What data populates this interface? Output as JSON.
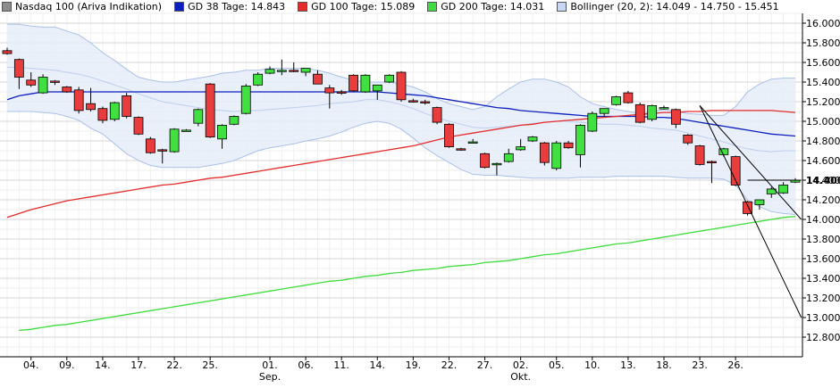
{
  "legend": [
    {
      "label": "Nasdaq 100 (Ariva Indikation)",
      "color": "#8c8c8c"
    },
    {
      "label": "GD 38 Tage: 14.843",
      "color": "#0b1fbf"
    },
    {
      "label": "GD 100 Tage: 15.089",
      "color": "#e42b2b"
    },
    {
      "label": "GD 200 Tage: 14.031",
      "color": "#3fdc3f"
    },
    {
      "label": "Bollinger (20, 2): 14.049 - 14.750 - 15.451",
      "color": "#a8c0e8"
    }
  ],
  "chart_data": {
    "type": "candlestick",
    "ylim": [
      12.6,
      16.1
    ],
    "y_ticks": [
      "16.000",
      "15.800",
      "15.600",
      "15.400",
      "15.200",
      "15.000",
      "14.800",
      "14.600",
      "14.400",
      "14.200",
      "14.000",
      "13.800",
      "13.600",
      "13.400",
      "13.200",
      "13.000",
      "12.800"
    ],
    "x_ticks": [
      "04.",
      "09.",
      "14.",
      "17.",
      "22.",
      "25.",
      "01.",
      "06.",
      "11.",
      "14.",
      "19.",
      "22.",
      "27.",
      "02.",
      "05.",
      "10.",
      "13.",
      "18.",
      "23.",
      "26."
    ],
    "x_month_labels": [
      "Sep.",
      "Okt."
    ],
    "last_value": "14.400",
    "candles": [
      {
        "o": 15.72,
        "h": 15.75,
        "l": 15.68,
        "c": 15.69
      },
      {
        "o": 15.63,
        "h": 15.64,
        "l": 15.33,
        "c": 15.45
      },
      {
        "o": 15.42,
        "h": 15.5,
        "l": 15.35,
        "c": 15.37
      },
      {
        "o": 15.29,
        "h": 15.48,
        "l": 15.28,
        "c": 15.45
      },
      {
        "o": 15.41,
        "h": 15.42,
        "l": 15.37,
        "c": 15.4
      },
      {
        "o": 15.35,
        "h": 15.36,
        "l": 15.29,
        "c": 15.3
      },
      {
        "o": 15.32,
        "h": 15.35,
        "l": 15.08,
        "c": 15.11
      },
      {
        "o": 15.18,
        "h": 15.34,
        "l": 15.1,
        "c": 15.12
      },
      {
        "o": 15.13,
        "h": 15.15,
        "l": 14.98,
        "c": 15.01
      },
      {
        "o": 15.02,
        "h": 15.2,
        "l": 15.0,
        "c": 15.19
      },
      {
        "o": 15.26,
        "h": 15.29,
        "l": 15.03,
        "c": 15.05
      },
      {
        "o": 15.04,
        "h": 15.05,
        "l": 14.86,
        "c": 14.87
      },
      {
        "o": 14.82,
        "h": 14.84,
        "l": 14.67,
        "c": 14.68
      },
      {
        "o": 14.71,
        "h": 14.72,
        "l": 14.57,
        "c": 14.7
      },
      {
        "o": 14.69,
        "h": 14.93,
        "l": 14.68,
        "c": 14.92
      },
      {
        "o": 14.91,
        "h": 14.92,
        "l": 14.9,
        "c": 14.91
      },
      {
        "o": 14.98,
        "h": 15.13,
        "l": 14.95,
        "c": 15.12
      },
      {
        "o": 15.38,
        "h": 15.39,
        "l": 14.83,
        "c": 14.84
      },
      {
        "o": 14.82,
        "h": 14.97,
        "l": 14.72,
        "c": 14.96
      },
      {
        "o": 14.97,
        "h": 15.06,
        "l": 14.96,
        "c": 15.05
      },
      {
        "o": 15.08,
        "h": 15.38,
        "l": 15.07,
        "c": 15.36
      },
      {
        "o": 15.37,
        "h": 15.5,
        "l": 15.36,
        "c": 15.48
      },
      {
        "o": 15.49,
        "h": 15.56,
        "l": 15.48,
        "c": 15.53
      },
      {
        "o": 15.52,
        "h": 15.63,
        "l": 15.47,
        "c": 15.52
      },
      {
        "o": 15.52,
        "h": 15.6,
        "l": 15.5,
        "c": 15.51
      },
      {
        "o": 15.5,
        "h": 15.53,
        "l": 15.46,
        "c": 15.54
      },
      {
        "o": 15.48,
        "h": 15.52,
        "l": 15.38,
        "c": 15.38
      },
      {
        "o": 15.34,
        "h": 15.37,
        "l": 15.13,
        "c": 15.29
      },
      {
        "o": 15.3,
        "h": 15.32,
        "l": 15.27,
        "c": 15.29
      },
      {
        "o": 15.47,
        "h": 15.48,
        "l": 15.3,
        "c": 15.31
      },
      {
        "o": 15.3,
        "h": 15.48,
        "l": 15.29,
        "c": 15.47
      },
      {
        "o": 15.31,
        "h": 15.35,
        "l": 15.22,
        "c": 15.37
      },
      {
        "o": 15.4,
        "h": 15.48,
        "l": 15.39,
        "c": 15.47
      },
      {
        "o": 15.5,
        "h": 15.51,
        "l": 15.2,
        "c": 15.22
      },
      {
        "o": 15.21,
        "h": 15.23,
        "l": 15.19,
        "c": 15.2
      },
      {
        "o": 15.2,
        "h": 15.22,
        "l": 15.17,
        "c": 15.19
      },
      {
        "o": 15.14,
        "h": 15.15,
        "l": 14.97,
        "c": 14.99
      },
      {
        "o": 14.97,
        "h": 14.98,
        "l": 14.73,
        "c": 14.74
      },
      {
        "o": 14.72,
        "h": 14.73,
        "l": 14.7,
        "c": 14.71
      },
      {
        "o": 14.79,
        "h": 14.82,
        "l": 14.78,
        "c": 14.79
      },
      {
        "o": 14.67,
        "h": 14.68,
        "l": 14.52,
        "c": 14.53
      },
      {
        "o": 14.56,
        "h": 14.58,
        "l": 14.45,
        "c": 14.57
      },
      {
        "o": 14.59,
        "h": 14.72,
        "l": 14.58,
        "c": 14.67
      },
      {
        "o": 14.71,
        "h": 14.82,
        "l": 14.7,
        "c": 14.74
      },
      {
        "o": 14.8,
        "h": 14.85,
        "l": 14.79,
        "c": 14.84
      },
      {
        "o": 14.78,
        "h": 14.79,
        "l": 14.55,
        "c": 14.58
      },
      {
        "o": 14.52,
        "h": 14.8,
        "l": 14.5,
        "c": 14.78
      },
      {
        "o": 14.78,
        "h": 14.8,
        "l": 14.72,
        "c": 14.73
      },
      {
        "o": 14.66,
        "h": 14.97,
        "l": 14.53,
        "c": 14.96
      },
      {
        "o": 14.9,
        "h": 15.1,
        "l": 14.89,
        "c": 15.08
      },
      {
        "o": 15.08,
        "h": 15.12,
        "l": 15.05,
        "c": 15.13
      },
      {
        "o": 15.17,
        "h": 15.26,
        "l": 15.16,
        "c": 15.25
      },
      {
        "o": 15.29,
        "h": 15.31,
        "l": 15.18,
        "c": 15.19
      },
      {
        "o": 15.17,
        "h": 15.19,
        "l": 14.98,
        "c": 14.99
      },
      {
        "o": 15.02,
        "h": 15.17,
        "l": 15.0,
        "c": 15.16
      },
      {
        "o": 15.13,
        "h": 15.16,
        "l": 15.12,
        "c": 15.14
      },
      {
        "o": 15.12,
        "h": 15.13,
        "l": 14.93,
        "c": 14.97
      },
      {
        "o": 14.86,
        "h": 14.87,
        "l": 14.76,
        "c": 14.78
      },
      {
        "o": 14.75,
        "h": 14.76,
        "l": 14.55,
        "c": 14.56
      },
      {
        "o": 14.59,
        "h": 14.6,
        "l": 14.37,
        "c": 14.58
      },
      {
        "o": 14.66,
        "h": 14.73,
        "l": 14.64,
        "c": 14.72
      },
      {
        "o": 14.64,
        "h": 14.65,
        "l": 14.34,
        "c": 14.35
      },
      {
        "o": 14.18,
        "h": 14.19,
        "l": 14.04,
        "c": 14.06
      },
      {
        "o": 14.15,
        "h": 14.2,
        "l": 14.1,
        "c": 14.2
      },
      {
        "o": 14.26,
        "h": 14.33,
        "l": 14.22,
        "c": 14.31
      },
      {
        "o": 14.27,
        "h": 14.38,
        "l": 14.26,
        "c": 14.35
      },
      {
        "o": 14.38,
        "h": 14.42,
        "l": 14.37,
        "c": 14.4
      }
    ],
    "series": [
      {
        "name": "GD 38 Tage",
        "color": "#0b1fbf",
        "values": [
          15.22,
          15.26,
          15.28,
          15.3,
          15.3,
          15.3,
          15.3,
          15.3,
          15.3,
          15.3,
          15.3,
          15.3,
          15.3,
          15.3,
          15.3,
          15.3,
          15.3,
          15.3,
          15.3,
          15.3,
          15.3,
          15.3,
          15.3,
          15.3,
          15.3,
          15.3,
          15.3,
          15.3,
          15.3,
          15.3,
          15.3,
          15.3,
          15.29,
          15.28,
          15.27,
          15.26,
          15.24,
          15.22,
          15.2,
          15.18,
          15.16,
          15.14,
          15.13,
          15.11,
          15.1,
          15.09,
          15.08,
          15.07,
          15.06,
          15.05,
          15.05,
          15.05,
          15.05,
          15.05,
          15.04,
          15.04,
          15.03,
          15.01,
          14.99,
          14.97,
          14.95,
          14.93,
          14.91,
          14.89,
          14.87,
          14.86,
          14.85
        ]
      },
      {
        "name": "GD 100 Tage",
        "color": "#e42b2b",
        "values": [
          14.02,
          14.06,
          14.1,
          14.13,
          14.16,
          14.19,
          14.21,
          14.23,
          14.25,
          14.27,
          14.29,
          14.31,
          14.33,
          14.35,
          14.36,
          14.38,
          14.4,
          14.42,
          14.43,
          14.45,
          14.47,
          14.49,
          14.51,
          14.53,
          14.55,
          14.57,
          14.59,
          14.61,
          14.63,
          14.65,
          14.67,
          14.69,
          14.71,
          14.73,
          14.75,
          14.78,
          14.81,
          14.84,
          14.86,
          14.88,
          14.9,
          14.92,
          14.94,
          14.96,
          14.97,
          14.99,
          15.0,
          15.01,
          15.02,
          15.03,
          15.04,
          15.05,
          15.06,
          15.07,
          15.08,
          15.09,
          15.09,
          15.1,
          15.1,
          15.11,
          15.11,
          15.11,
          15.11,
          15.11,
          15.11,
          15.1,
          15.09
        ]
      },
      {
        "name": "GD 200 Tage",
        "color": "#3fdc3f",
        "values": [
          null,
          12.87,
          12.88,
          12.9,
          12.92,
          12.93,
          12.95,
          12.97,
          12.99,
          13.01,
          13.03,
          13.05,
          13.07,
          13.09,
          13.11,
          13.13,
          13.15,
          13.17,
          13.19,
          13.21,
          13.23,
          13.25,
          13.27,
          13.29,
          13.31,
          13.33,
          13.35,
          13.37,
          13.38,
          13.4,
          13.42,
          13.43,
          13.45,
          13.46,
          13.48,
          13.49,
          13.5,
          13.52,
          13.53,
          13.54,
          13.56,
          13.57,
          13.58,
          13.6,
          13.62,
          13.64,
          13.65,
          13.67,
          13.69,
          13.71,
          13.73,
          13.75,
          13.76,
          13.78,
          13.8,
          13.82,
          13.84,
          13.86,
          13.88,
          13.9,
          13.92,
          13.94,
          13.96,
          13.98,
          14.0,
          14.02,
          14.03
        ]
      },
      {
        "name": "Bollinger (20, 2)",
        "color": "#a8c0e8",
        "upper": [
          15.99,
          15.99,
          15.97,
          15.96,
          15.96,
          15.92,
          15.88,
          15.8,
          15.7,
          15.62,
          15.53,
          15.45,
          15.42,
          15.4,
          15.4,
          15.42,
          15.44,
          15.46,
          15.49,
          15.5,
          15.52,
          15.52,
          15.54,
          15.54,
          15.54,
          15.54,
          15.52,
          15.49,
          15.45,
          15.42,
          15.4,
          15.4,
          15.4,
          15.38,
          15.35,
          15.3,
          15.23,
          15.18,
          15.15,
          15.12,
          15.15,
          15.25,
          15.33,
          15.4,
          15.43,
          15.43,
          15.4,
          15.35,
          15.25,
          15.18,
          15.15,
          15.12,
          15.1,
          15.08,
          15.1,
          15.12,
          15.1,
          15.08,
          15.07,
          15.06,
          15.06,
          15.15,
          15.3,
          15.38,
          15.43,
          15.44,
          15.44
        ],
        "middle": [
          15.55,
          15.55,
          15.54,
          15.53,
          15.52,
          15.5,
          15.48,
          15.45,
          15.41,
          15.37,
          15.33,
          15.28,
          15.24,
          15.2,
          15.18,
          15.16,
          15.14,
          15.12,
          15.11,
          15.1,
          15.11,
          15.11,
          15.12,
          15.13,
          15.14,
          15.15,
          15.16,
          15.18,
          15.19,
          15.2,
          15.22,
          15.22,
          15.2,
          15.17,
          15.13,
          15.08,
          15.04,
          15.0,
          14.97,
          14.94,
          14.93,
          14.94,
          14.95,
          14.96,
          14.98,
          14.99,
          15.0,
          15.0,
          14.99,
          14.98,
          14.97,
          14.97,
          14.96,
          14.95,
          14.93,
          14.92,
          14.91,
          14.88,
          14.85,
          14.82,
          14.79,
          14.75,
          14.72,
          14.7,
          14.69,
          14.7,
          14.7
        ],
        "lower": [
          15.1,
          15.1,
          15.1,
          15.09,
          15.08,
          15.05,
          15.01,
          14.93,
          14.87,
          14.77,
          14.67,
          14.6,
          14.55,
          14.53,
          14.53,
          14.53,
          14.53,
          14.55,
          14.57,
          14.6,
          14.65,
          14.7,
          14.73,
          14.75,
          14.77,
          14.8,
          14.82,
          14.85,
          14.89,
          14.94,
          14.98,
          15.0,
          14.98,
          14.92,
          14.83,
          14.73,
          14.65,
          14.58,
          14.51,
          14.46,
          14.45,
          14.45,
          14.44,
          14.43,
          14.42,
          14.42,
          14.42,
          14.42,
          14.43,
          14.43,
          14.43,
          14.44,
          14.44,
          14.44,
          14.44,
          14.44,
          14.43,
          14.42,
          14.42,
          14.42,
          14.41,
          14.35,
          14.2,
          14.13,
          14.08,
          14.06,
          14.05
        ]
      }
    ],
    "trendlines": [
      {
        "x1": 58.0,
        "y1": 15.16,
        "x2": 66.5,
        "y2": 14.0
      },
      {
        "x1": 58.0,
        "y1": 15.16,
        "x2": 66.5,
        "y2": 13.0
      }
    ],
    "support_line": {
      "x1": 62,
      "x2": 66.5,
      "y": 14.4
    }
  }
}
